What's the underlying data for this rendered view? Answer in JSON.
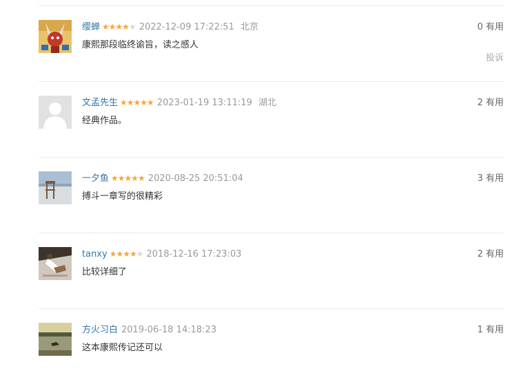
{
  "comments": [
    {
      "user": "缨蝉",
      "rating": 4,
      "time": "2022-12-09 17:22:51",
      "location": "北京",
      "content": "康熙那段临终谕旨，读之感人",
      "useful": "0 有用",
      "report": "投诉"
    },
    {
      "user": "文孟先生",
      "rating": 5,
      "time": "2023-01-19 13:11:19",
      "location": "湖北",
      "content": "经典作品。",
      "useful": "2 有用"
    },
    {
      "user": "一夕鱼",
      "rating": 5,
      "time": "2020-08-25 20:51:04",
      "content": "搏斗一章写的很精彩",
      "useful": "3 有用"
    },
    {
      "user": "tanxy",
      "rating": 4,
      "time": "2018-12-16 17:23:03",
      "content": "比较详细了",
      "useful": "2 有用"
    },
    {
      "user": "方火习白",
      "time": "2019-06-18 14:18:23",
      "content": "这本康熙传记还可以",
      "useful": "1 有用"
    }
  ],
  "colors": {
    "link": "#3377aa",
    "star_on": "#f7a53b",
    "star_off": "#d8d8d8",
    "muted": "#999999"
  }
}
